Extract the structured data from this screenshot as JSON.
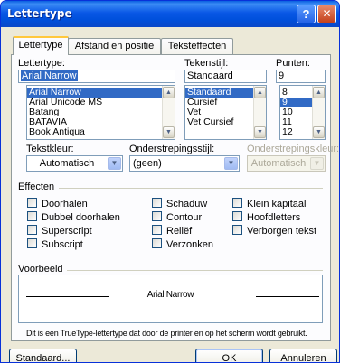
{
  "window": {
    "title": "Lettertype"
  },
  "tabs": [
    {
      "label": "Lettertype",
      "active": true
    },
    {
      "label": "Afstand en positie",
      "active": false
    },
    {
      "label": "Teksteffecten",
      "active": false
    }
  ],
  "font": {
    "label": "Lettertype:",
    "value": "Arial Narrow",
    "items": [
      "Arial Narrow",
      "Arial Unicode MS",
      "Batang",
      "BATAVIA",
      "Book Antiqua"
    ],
    "selected": "Arial Narrow"
  },
  "style": {
    "label": "Tekenstijl:",
    "value": "Standaard",
    "items": [
      "Standaard",
      "Cursief",
      "Vet",
      "Vet Cursief"
    ],
    "selected": "Standaard"
  },
  "size": {
    "label": "Punten:",
    "value": "9",
    "items": [
      "8",
      "9",
      "10",
      "11",
      "12"
    ],
    "selected": "9"
  },
  "color": {
    "label": "Tekstkleur:",
    "value": "Automatisch"
  },
  "underline": {
    "label": "Onderstrepingsstijl:",
    "value": "(geen)"
  },
  "underline_color": {
    "label": "Onderstrepingskleur:",
    "value": "Automatisch",
    "disabled": true
  },
  "effects": {
    "label": "Effecten",
    "options": [
      {
        "label": "Doorhalen",
        "checked": false
      },
      {
        "label": "Dubbel doorhalen",
        "checked": false
      },
      {
        "label": "Superscript",
        "checked": false
      },
      {
        "label": "Subscript",
        "checked": false
      },
      {
        "label": "Schaduw",
        "checked": false
      },
      {
        "label": "Contour",
        "checked": false
      },
      {
        "label": "Reliëf",
        "checked": false
      },
      {
        "label": "Verzonken",
        "checked": false
      },
      {
        "label": "Klein kapitaal",
        "checked": false
      },
      {
        "label": "Hoofdletters",
        "checked": false
      },
      {
        "label": "Verborgen tekst",
        "checked": false
      }
    ]
  },
  "preview": {
    "label": "Voorbeeld",
    "sample": "Arial Narrow",
    "note": "Dit is een TrueType-lettertype dat door de printer en op het scherm wordt gebruikt."
  },
  "buttons": {
    "default": "Standaard...",
    "ok": "OK",
    "cancel": "Annuleren"
  },
  "titlebar_buttons": {
    "help": "?",
    "close": "✕"
  },
  "colors": {
    "selection": "#316ac5",
    "titlebar": "#0a58e6",
    "dialog": "#ece9d8",
    "tab_highlight": "#ffc83c"
  }
}
